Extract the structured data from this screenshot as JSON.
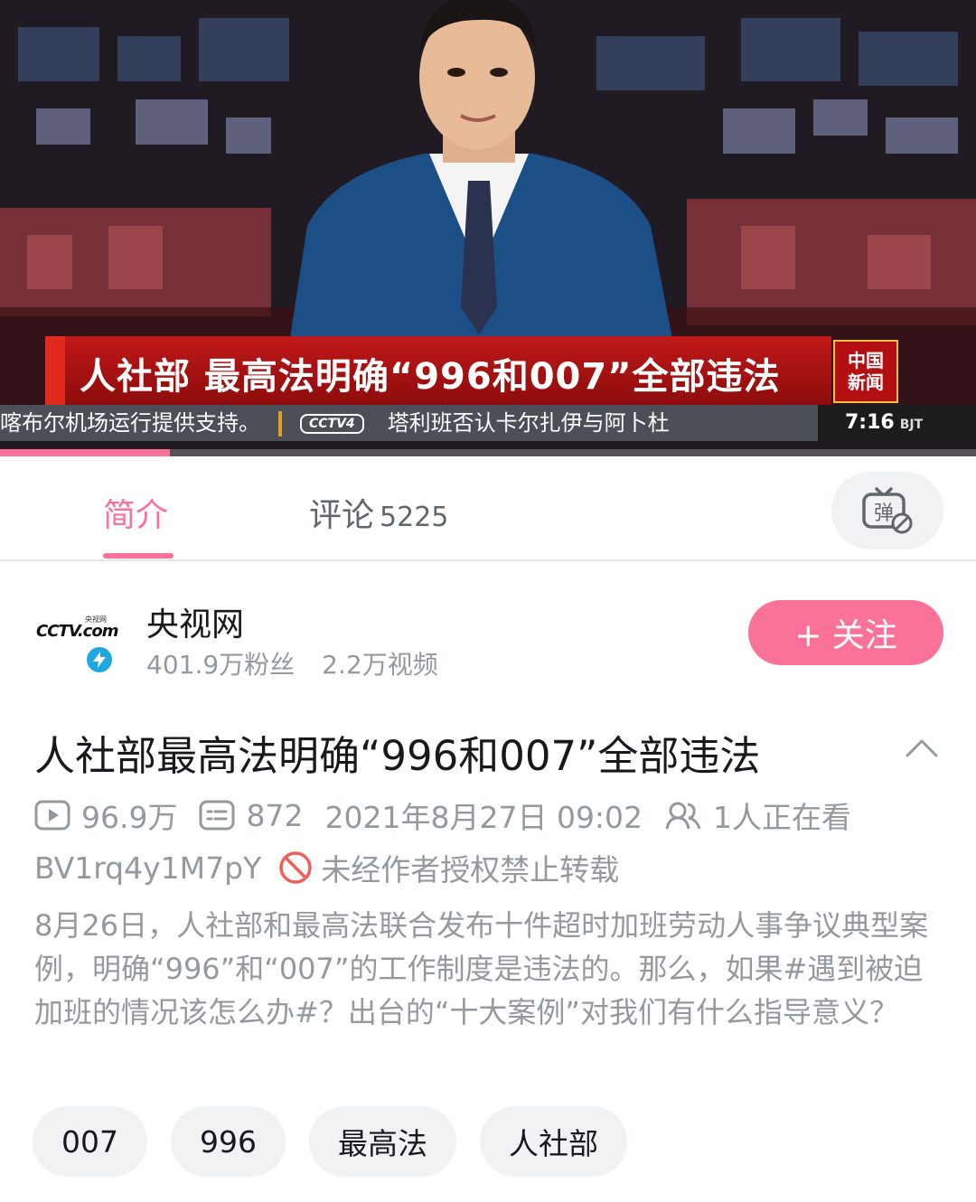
{
  "video": {
    "headline": "人社部 最高法明确“996和007”全部违法",
    "channel_logo_line1": "中国",
    "channel_logo_line2": "新闻",
    "ticker_left": "喀布尔机场运行提供支持。",
    "ticker_mini_logo": "CCTV4",
    "ticker_right": "塔利班否认卡尔扎伊与阿卜杜",
    "clock_time": "7:16",
    "clock_zone": "BJT",
    "progress_fraction": 0.174
  },
  "tabs": {
    "intro_label": "简介",
    "comments_label": "评论",
    "comments_count": "5225",
    "danmaku_icon": "danmaku-icon"
  },
  "uploader": {
    "name": "央视网",
    "fans": "401.9万粉丝",
    "videos": "2.2万视频",
    "avatar_text": "CCTV.com",
    "avatar_sub": "央视网",
    "follow_label": "+ 关注"
  },
  "video_info": {
    "title": "人社部最高法明确“996和007”全部违法",
    "views": "96.9万",
    "danmaku_count": "872",
    "publish_time": "2021年8月27日 09:02",
    "watching": "1人正在看",
    "bvid": "BV1rq4y1M7pY",
    "copyright_notice": "未经作者授权禁止转载",
    "description": "8月26日，人社部和最高法联合发布十件超时加班劳动人事争议典型案例，明确“996”和“007”的工作制度是违法的。那么，如果#遇到被迫加班的情况该怎么办#？出台的“十大案例”对我们有什么指导意义？"
  },
  "tags": [
    "007",
    "996",
    "最高法",
    "人社部"
  ],
  "colors": {
    "accent_pink": "#fb7299",
    "text_primary": "#18191c",
    "text_secondary": "#9499a0",
    "verified_blue": "#21a7e0",
    "forbid_red": "#f25d59"
  }
}
